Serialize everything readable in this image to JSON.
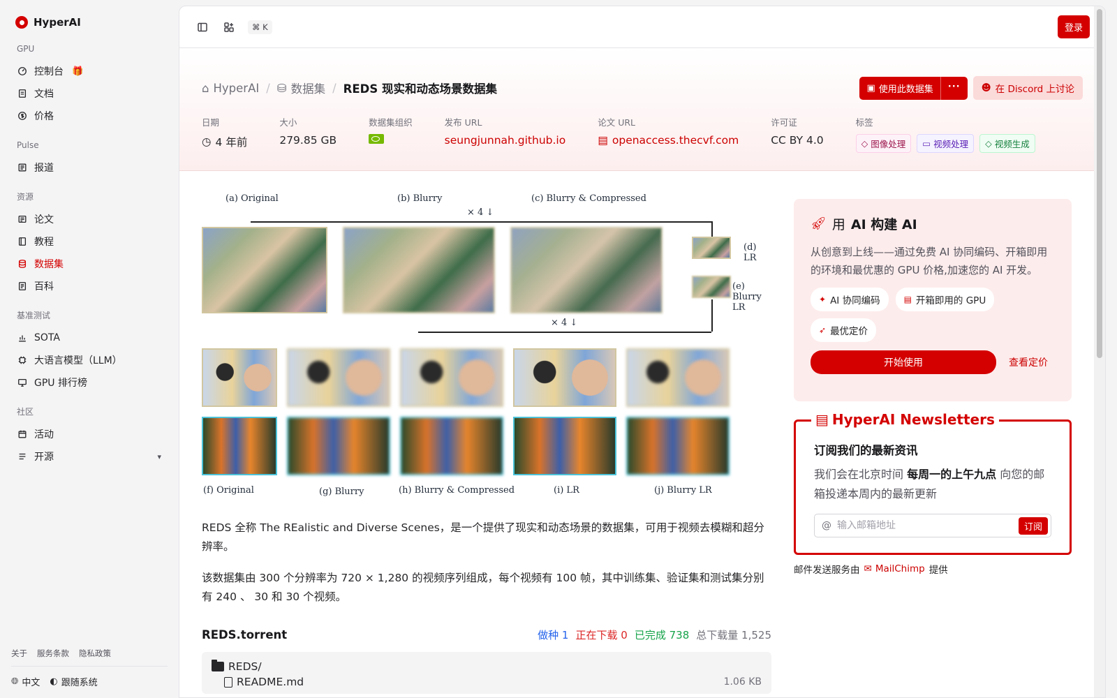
{
  "brand": {
    "name": "HyperAI"
  },
  "sidebar": {
    "sections": [
      {
        "label": "GPU",
        "items": [
          {
            "label": "控制台",
            "icon": "gauge-icon",
            "badge": "gift"
          },
          {
            "label": "文档",
            "icon": "doc-icon"
          },
          {
            "label": "价格",
            "icon": "dollar-icon"
          }
        ]
      },
      {
        "label": "Pulse",
        "items": [
          {
            "label": "报道",
            "icon": "news-icon"
          }
        ]
      },
      {
        "label": "资源",
        "items": [
          {
            "label": "论文",
            "icon": "paper-icon"
          },
          {
            "label": "教程",
            "icon": "book-icon"
          },
          {
            "label": "数据集",
            "icon": "database-icon",
            "active": true
          },
          {
            "label": "百科",
            "icon": "wiki-icon"
          }
        ]
      },
      {
        "label": "基准测试",
        "items": [
          {
            "label": "SOTA",
            "icon": "chart-icon"
          },
          {
            "label": "大语言模型（LLM）",
            "icon": "cpu-icon"
          },
          {
            "label": "GPU 排行榜",
            "icon": "monitor-icon"
          }
        ]
      },
      {
        "label": "社区",
        "items": [
          {
            "label": "活动",
            "icon": "calendar-icon"
          },
          {
            "label": "开源",
            "icon": "code-icon",
            "expandable": true
          }
        ]
      }
    ],
    "footer_links": [
      "关于",
      "服务条款",
      "隐私政策"
    ],
    "language": "中文",
    "theme": "跟随系统"
  },
  "topbar": {
    "shortcut_key": "K",
    "login_label": "登录"
  },
  "breadcrumb": {
    "home": "HyperAI",
    "section": "数据集",
    "current": "REDS 现实和动态场景数据集"
  },
  "actions": {
    "use_dataset": "使用此数据集",
    "more": "···",
    "discord": "在 Discord 上讨论"
  },
  "meta": {
    "date_label": "日期",
    "date_value": "4 年前",
    "size_label": "大小",
    "size_value": "279.85 GB",
    "org_label": "数据集组织",
    "release_url_label": "发布 URL",
    "release_url": "seungjunnah.github.io",
    "paper_url_label": "论文 URL",
    "paper_url": "openaccess.thecvf.com",
    "license_label": "许可证",
    "license_value": "CC BY 4.0",
    "tags_label": "标签",
    "tags": [
      "图像处理",
      "视频处理",
      "视频生成"
    ]
  },
  "figure": {
    "labels": {
      "a": "(a) Original",
      "b": "(b) Blurry",
      "c": "(c) Blurry & Compressed",
      "d": "(d) LR",
      "e": "(e) Blurry LR",
      "f": "(f) Original",
      "g": "(g) Blurry",
      "h": "(h) Blurry & Compressed",
      "i": "(i) LR",
      "j": "(j) Blurry LR",
      "down_top": "× 4 ↓",
      "down_bottom": "× 4 ↓"
    }
  },
  "description": {
    "p1": "REDS 全称 The REalistic and Diverse Scenes，是一个提供了现实和动态场景的数据集，可用于视频去模糊和超分辨率。",
    "p2": "该数据集由 300 个分辨率为 720 × 1,280 的视频序列组成，每个视频有 100 帧，其中训练集、验证集和测试集分别有 240 、 30 和 30 个视频。"
  },
  "torrent": {
    "title": "REDS.torrent",
    "seed_label": "做种",
    "seed_value": "1",
    "downloading_label": "正在下载",
    "downloading_value": "0",
    "completed_label": "已完成",
    "completed_value": "738",
    "total_label": "总下载量",
    "total_value": "1,525",
    "folder": "REDS/",
    "file_name": "README.md",
    "file_size": "1.06 KB"
  },
  "ai_card": {
    "title_prefix": "用",
    "title_bold": "AI 构建 AI",
    "description": "从创意到上线——通过免费 AI 协同编码、开箱即用的环境和最优惠的 GPU 价格,加速您的 AI 开发。",
    "chips": [
      "AI 协同编码",
      "开箱即用的 GPU",
      "最优定价"
    ],
    "start_label": "开始使用",
    "pricing_label": "查看定价"
  },
  "newsletter": {
    "legend": "HyperAI Newsletters",
    "heading": "订阅我们的最新资讯",
    "desc_before": "我们会在北京时间",
    "desc_bold": "每周一的上午九点",
    "desc_after": "向您的邮箱投递本周内的最新更新",
    "placeholder": "输入邮箱地址",
    "subscribe_label": "订阅",
    "provider_prefix": "邮件发送服务由",
    "provider_name": "MailChimp",
    "provider_suffix": "提供"
  },
  "colors": {
    "accent": "#d40000",
    "sidebar_bg": "#f4f4f5"
  }
}
